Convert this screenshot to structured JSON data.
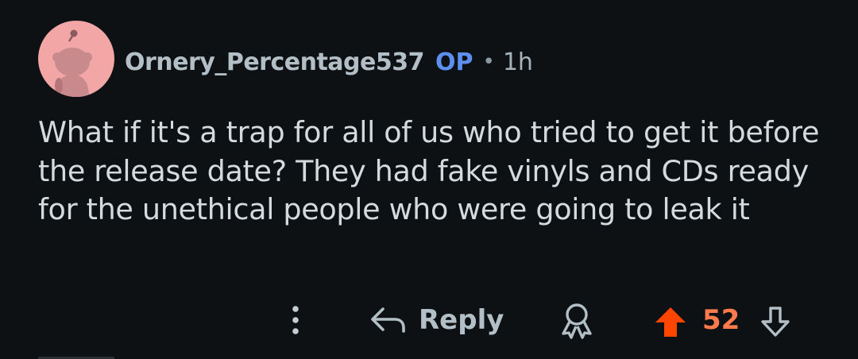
{
  "comment": {
    "author": "Ornery_Percentage537",
    "op_badge": "OP",
    "separator": "•",
    "time": "1h",
    "body": "What if it's a trap for all of us who tried to get it before the release date? They had fake vinyls and CDs ready for the unethical people who were going to leak it",
    "avatar_color": "#f3a6a6",
    "avatar_icon": "snoo-avatar-icon"
  },
  "actions": {
    "more_icon": "more-vertical-icon",
    "reply_icon": "reply-arrow-icon",
    "reply_label": "Reply",
    "award_icon": "award-icon",
    "upvote_icon": "upvote-arrow-icon",
    "score": "52",
    "downvote_icon": "downvote-arrow-icon"
  },
  "colors": {
    "background": "#0e1113",
    "username": "#b3bfc6",
    "op_badge": "#5d8ff0",
    "body_text": "#d4dadd",
    "upvote_active": "#ff4500",
    "score": "#ff7a4d"
  }
}
